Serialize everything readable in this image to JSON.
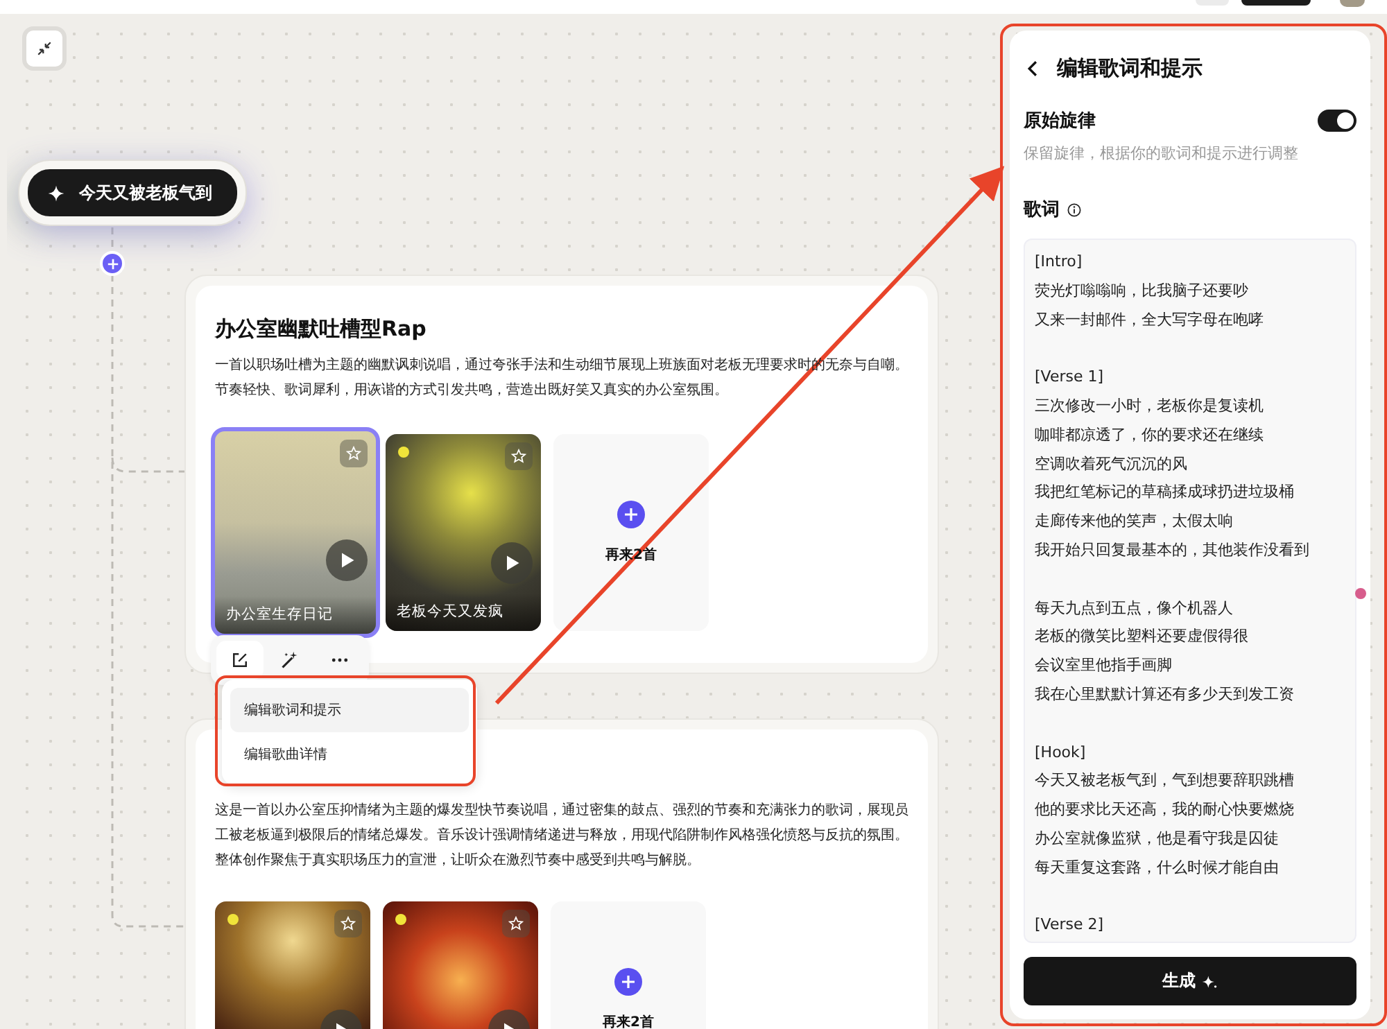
{
  "prompt_node": {
    "label": "今天又被老板气到"
  },
  "groups": [
    {
      "title": "办公室幽默吐槽型Rap",
      "description": "一首以职场吐槽为主题的幽默讽刺说唱，通过夸张手法和生动细节展现上班族面对老板无理要求时的无奈与自嘲。节奏轻快、歌词犀利，用诙谐的方式引发共鸣，营造出既好笑又真实的办公室氛围。",
      "songs": [
        {
          "title": "办公室生存日记",
          "selected": true,
          "marked": false
        },
        {
          "title": "老板今天又发疯",
          "selected": false,
          "marked": true
        }
      ],
      "more_label": "再来2首"
    },
    {
      "description": "这是一首以办公室压抑情绪为主题的爆发型快节奏说唱，通过密集的鼓点、强烈的节奏和充满张力的歌词，展现员工被老板逼到极限后的情绪总爆发。音乐设计强调情绪递进与释放，用现代陷阱制作风格强化愤怒与反抗的氛围。整体创作聚焦于真实职场压力的宣泄，让听众在激烈节奏中感受到共鸣与解脱。",
      "songs": [
        {
          "selected": false,
          "marked": true
        },
        {
          "selected": false,
          "marked": true
        }
      ],
      "more_label": "再来2首"
    }
  ],
  "context_menu": {
    "items": [
      {
        "label": "编辑歌词和提示",
        "selected": true
      },
      {
        "label": "编辑歌曲详情",
        "selected": false
      }
    ]
  },
  "panel": {
    "title": "编辑歌词和提示",
    "melody": {
      "label": "原始旋律",
      "on": true,
      "hint": "保留旋律，根据你的歌词和提示进行调整"
    },
    "lyrics_label": "歌词",
    "lyrics": [
      [
        "[Intro]",
        "荧光灯嗡嗡响，比我脑子还要吵",
        "又来一封邮件，全大写字母在咆哮"
      ],
      [
        "[Verse 1]",
        "三次修改一小时，老板你是复读机",
        "咖啡都凉透了，你的要求还在继续",
        "空调吹着死气沉沉的风",
        "我把红笔标记的草稿揉成球扔进垃圾桶",
        "走廊传来他的笑声，太假太响",
        "我开始只回复最基本的，其他装作没看到"
      ],
      [
        "每天九点到五点，像个机器人",
        "老板的微笑比塑料还要虚假得很",
        "会议室里他指手画脚",
        "我在心里默默计算还有多少天到发工资"
      ],
      [
        "[Hook]",
        "今天又被老板气到，气到想要辞职跳槽",
        "他的要求比天还高，我的耐心快要燃烧",
        "办公室就像监狱，他是看守我是囚徒",
        "每天重复这套路，什么时候才能自由"
      ],
      [
        "[Verse 2]"
      ]
    ],
    "generate_label": "生成"
  }
}
